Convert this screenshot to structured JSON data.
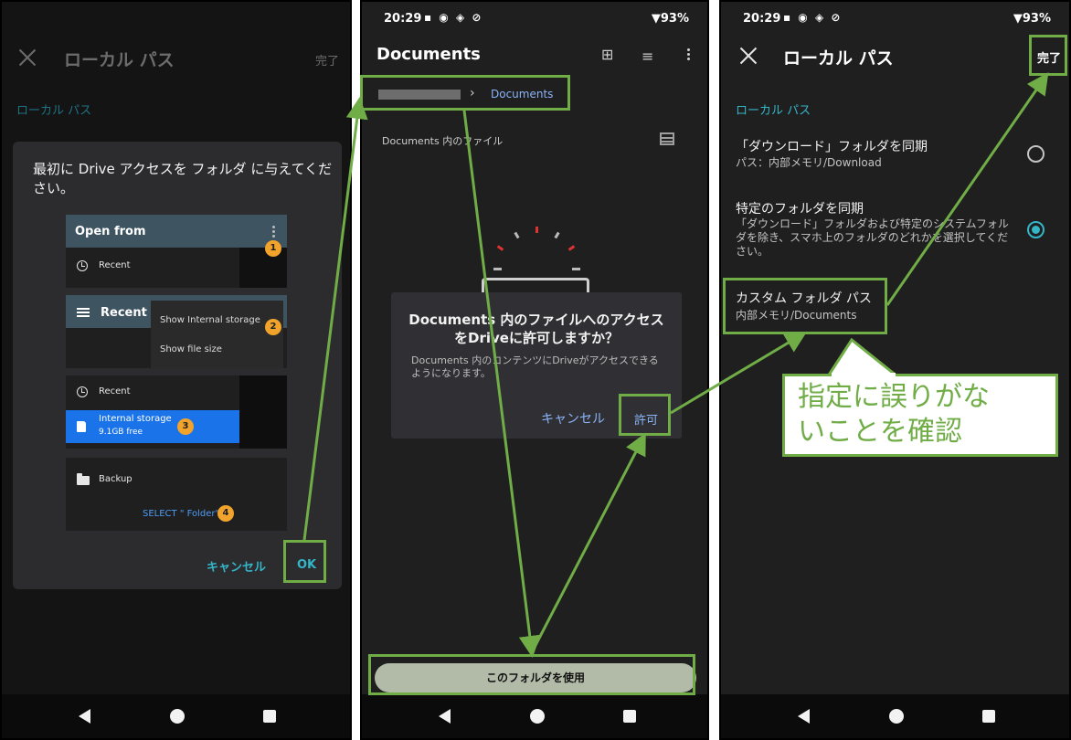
{
  "panel1": {
    "title": "ローカル パス",
    "done": "完了",
    "section_label": "ローカル パス",
    "dialog_message": "最初に Drive アクセスを フォルダ に与えてください。",
    "tile1": {
      "header": "Open from",
      "item": "Recent",
      "badge": "1"
    },
    "tile2": {
      "header": "Recent",
      "menu_item1": "Show Internal storage",
      "menu_item2": "Show file size",
      "badge": "2"
    },
    "tile3": {
      "item": "Recent",
      "storage_name": "Internal storage",
      "storage_free": "9.1GB free",
      "badge": "3"
    },
    "tile4": {
      "item": "Backup",
      "select_label": "SELECT \" Folder\"",
      "badge": "4"
    },
    "cancel": "キャンセル",
    "ok": "OK"
  },
  "panel2": {
    "status_time": "20:29",
    "status_battery": "93%",
    "title": "Documents",
    "breadcrumb_current": "Documents",
    "files_label": "Documents 内のファイル",
    "dialog_title": "Documents 内のファイルへのアクセスをDriveに許可しますか？",
    "dialog_body": "Documents 内のコンテンツにDriveがアクセスできるようになります。",
    "cancel": "キャンセル",
    "allow": "許可",
    "use_folder": "このフォルダを使用"
  },
  "panel3": {
    "status_time": "20:29",
    "status_battery": "93%",
    "title": "ローカル パス",
    "done": "完了",
    "section_label": "ローカル パス",
    "option1_title": "「ダウンロード」フォルダを同期",
    "option1_sub": "パス：内部メモリ/Download",
    "option2_title": "特定のフォルダを同期",
    "option2_sub": "「ダウンロード」フォルダおよび特定のシステムフォルダを除き、スマホ上のフォルダのどれかを選択してください。",
    "option3_title": "カスタム フォルダ パス",
    "option3_sub": "内部メモリ/Documents"
  },
  "callout": {
    "line1": "指定に誤りがな",
    "line2": "いことを確認"
  },
  "colors": {
    "highlight": "#70ad47",
    "accent": "#34b6c9",
    "link": "#8ab4f8"
  }
}
